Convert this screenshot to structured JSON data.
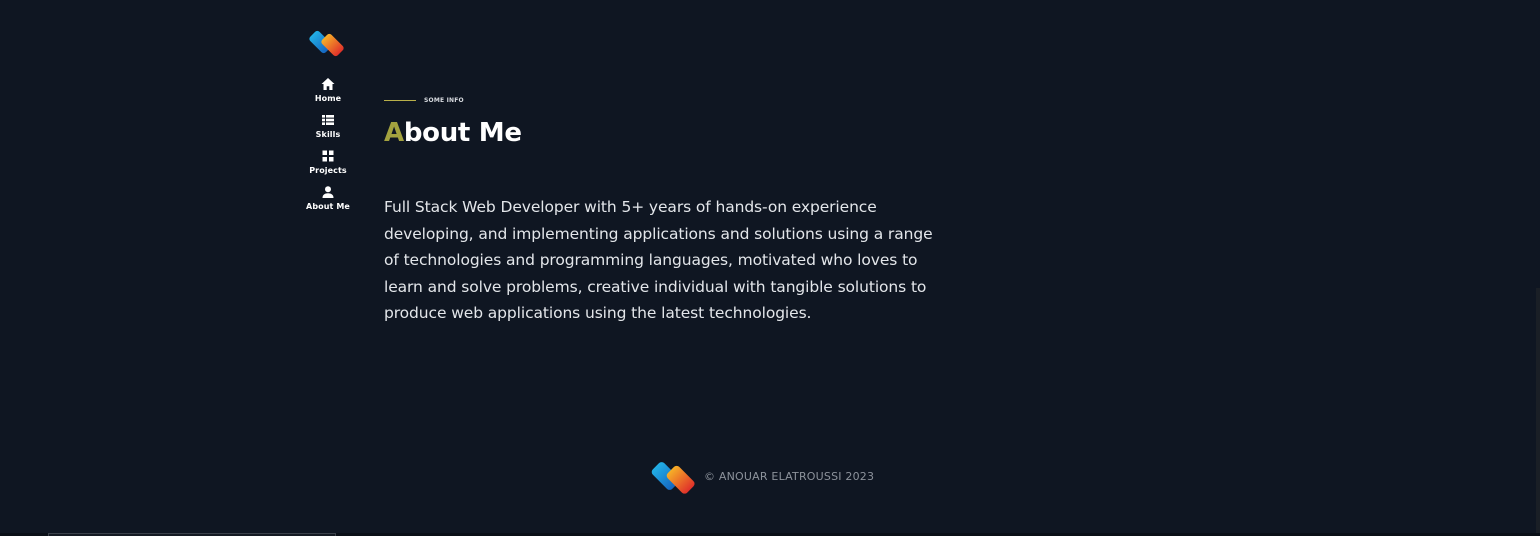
{
  "brand": {
    "logo_icon": "diamond-logo-icon",
    "colors": {
      "blue_top": "#1fa3de",
      "blue_bottom": "#1474c8",
      "orange_top": "#f5a623",
      "red_bottom": "#e23b2e"
    }
  },
  "nav": {
    "items": [
      {
        "label": "Home",
        "icon": "home-icon"
      },
      {
        "label": "Skills",
        "icon": "list-icon"
      },
      {
        "label": "Projects",
        "icon": "grid-icon"
      },
      {
        "label": "About Me",
        "icon": "user-icon"
      }
    ]
  },
  "about": {
    "eyebrow": "SOME INFO",
    "heading_first_letter": "A",
    "heading_rest": "bout Me",
    "description": "Full Stack Web Developer with 5+ years of hands-on experience developing, and implementing applications and solutions using a range of technologies and programming languages, motivated who loves to learn and solve problems, creative individual with tangible solutions to produce web applications using the latest technologies."
  },
  "footer": {
    "copyright": "© ANOUAR ELATROUSSI 2023"
  },
  "theme": {
    "background": "#0f1622",
    "accent": "#a3a23f",
    "eyebrow_line": "#b9b04a"
  }
}
